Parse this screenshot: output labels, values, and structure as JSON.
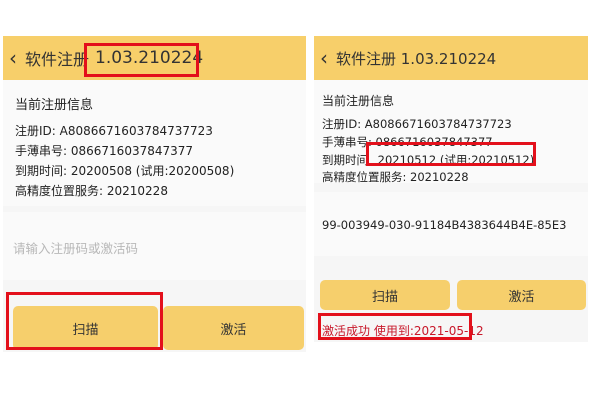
{
  "left": {
    "header": {
      "back_icon": "chevron-left-icon",
      "title": "软件注册",
      "version": "1.03.210224"
    },
    "info": {
      "title": "当前注册信息",
      "reg_id_label": "注册ID:",
      "reg_id": "A8086671603784737723",
      "serial_label": "手薄串号:",
      "serial": "0866716037847377",
      "expiry_label": "到期时间:",
      "expiry": "20200508 (试用:20200508)",
      "service_label": "高精度位置服务:",
      "service": "20210228"
    },
    "input": {
      "placeholder": "请输入注册码或激活码"
    },
    "buttons": {
      "scan": "扫描",
      "activate": "激活"
    }
  },
  "right": {
    "header": {
      "back_icon": "chevron-left-icon",
      "title": "软件注册 1.03.210224"
    },
    "info": {
      "title": "当前注册信息",
      "reg_id_label": "注册ID:",
      "reg_id": "A8086671603784737723",
      "serial_label": "手薄串号:",
      "serial": "0866716037847377",
      "expiry_label": "到期时间",
      "expiry": "20210512 (试用:20210512)",
      "service_label": "高精度位置服务:",
      "service": "20210228"
    },
    "input": {
      "value": "99-003949-030-91184B4383644B4E-85E3"
    },
    "buttons": {
      "scan": "扫描",
      "activate": "激活"
    },
    "status": "激活成功 使用到:2021-05-12"
  },
  "colors": {
    "header": "#f7cf6a",
    "button": "#f6cf6c",
    "highlight": "#e3101b",
    "status_text": "#c8182a"
  }
}
